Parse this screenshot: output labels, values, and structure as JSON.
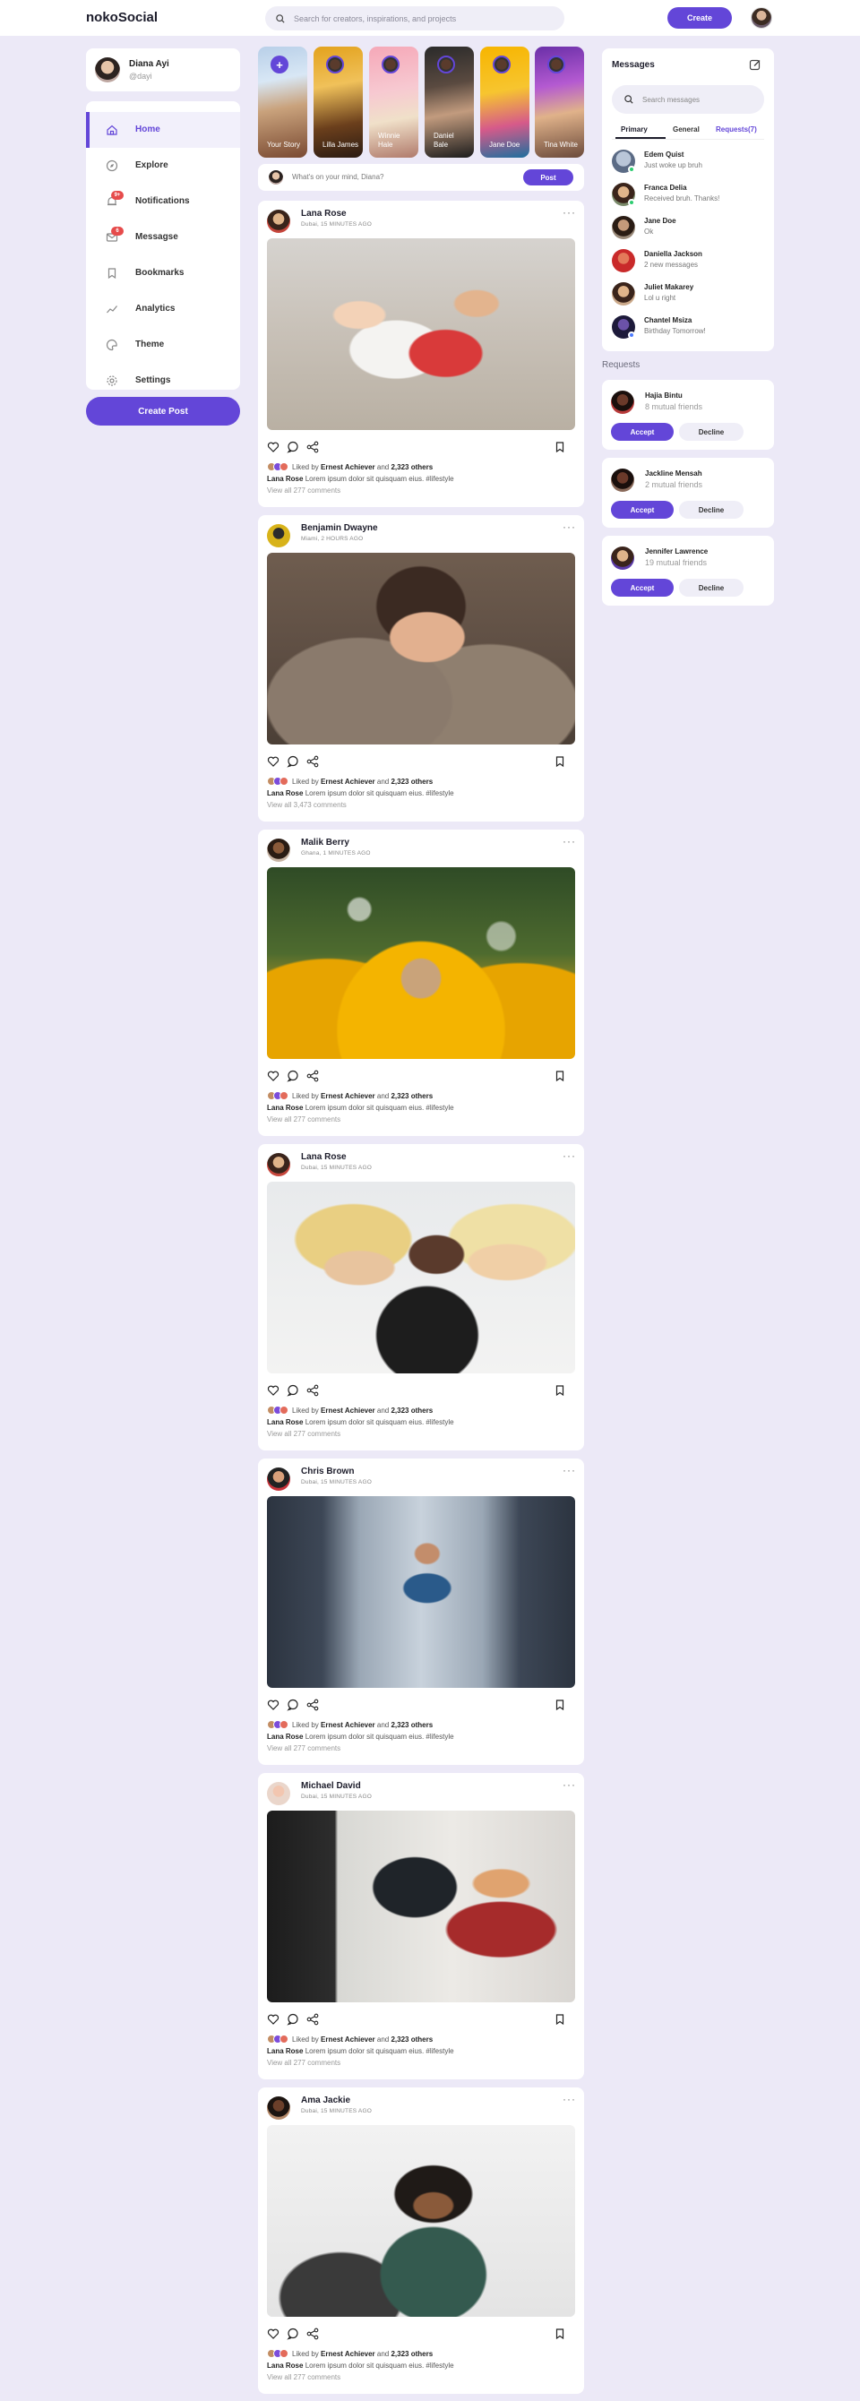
{
  "app": {
    "logo": "nokoSocial"
  },
  "topbar": {
    "search_placeholder": "Search for creators, inspirations, and projects",
    "create_label": "Create"
  },
  "profile": {
    "name": "Diana Ayi",
    "handle": "@dayi"
  },
  "sidebar": {
    "items": [
      {
        "label": "Home",
        "icon": "home-icon",
        "active": true
      },
      {
        "label": "Explore",
        "icon": "compass-icon"
      },
      {
        "label": "Notifications",
        "icon": "bell-icon",
        "badge": "9+"
      },
      {
        "label": "Messagse",
        "icon": "envelope-icon",
        "badge": "6"
      },
      {
        "label": "Bookmarks",
        "icon": "bookmark-icon"
      },
      {
        "label": "Analytics",
        "icon": "chart-icon"
      },
      {
        "label": "Theme",
        "icon": "palette-icon"
      },
      {
        "label": "Settings",
        "icon": "gear-icon"
      }
    ],
    "create_post_label": "Create Post"
  },
  "stories": [
    {
      "name": "Your Story"
    },
    {
      "name": "Lilla James"
    },
    {
      "name": "Winnie Hale"
    },
    {
      "name": "Daniel Bale"
    },
    {
      "name": "Jane Doe"
    },
    {
      "name": "Tina White"
    }
  ],
  "composer": {
    "placeholder": "What's on your mind, Diana?",
    "post_label": "Post"
  },
  "posts": [
    {
      "name": "Lana Rose",
      "meta": "Dubai, 15 MINUTES AGO",
      "liked_by": "Ernest Achiever",
      "liked_others": "2,323 others",
      "caption_name": "Lana Rose",
      "caption_text": "Lorem ipsum dolor sit quisquam eius. #lifestyle",
      "comments": "View all 277 comments"
    },
    {
      "name": "Benjamin Dwayne",
      "meta": "Miami, 2 HOURS AGO",
      "liked_by": "Ernest Achiever",
      "liked_others": "2,323 others",
      "caption_name": "Lana Rose",
      "caption_text": "Lorem ipsum dolor sit quisquam eius. #lifestyle",
      "comments": "View all 3,473 comments"
    },
    {
      "name": "Malik Berry",
      "meta": "Ghana, 1 MINUTES AGO",
      "liked_by": "Ernest Achiever",
      "liked_others": "2,323 others",
      "caption_name": "Lana Rose",
      "caption_text": "Lorem ipsum dolor sit quisquam eius. #lifestyle",
      "comments": "View all 277 comments"
    },
    {
      "name": "Lana Rose",
      "meta": "Dubai, 15 MINUTES AGO",
      "liked_by": "Ernest Achiever",
      "liked_others": "2,323 others",
      "caption_name": "Lana Rose",
      "caption_text": "Lorem ipsum dolor sit quisquam eius. #lifestyle",
      "comments": "View all 277 comments"
    },
    {
      "name": "Chris Brown",
      "meta": "Dubai, 15 MINUTES AGO",
      "liked_by": "Ernest Achiever",
      "liked_others": "2,323 others",
      "caption_name": "Lana Rose",
      "caption_text": "Lorem ipsum dolor sit quisquam eius. #lifestyle",
      "comments": "View all 277 comments"
    },
    {
      "name": "Michael David",
      "meta": "Dubai, 15 MINUTES AGO",
      "liked_by": "Ernest Achiever",
      "liked_others": "2,323 others",
      "caption_name": "Lana Rose",
      "caption_text": "Lorem ipsum dolor sit quisquam eius. #lifestyle",
      "comments": "View all 277 comments"
    },
    {
      "name": "Ama Jackie",
      "meta": "Dubai, 15 MINUTES AGO",
      "liked_by": "Ernest Achiever",
      "liked_others": "2,323 others",
      "caption_name": "Lana Rose",
      "caption_text": "Lorem ipsum dolor sit quisquam eius. #lifestyle",
      "comments": "View all 277 comments"
    }
  ],
  "messages": {
    "title": "Messages",
    "search_placeholder": "Search messages",
    "tabs": {
      "primary": "Primary",
      "general": "General",
      "requests": "Requests(7)"
    },
    "items": [
      {
        "name": "Edem Quist",
        "text": "Just woke up bruh"
      },
      {
        "name": "Franca Delia",
        "text": "Received bruh. Thanks!"
      },
      {
        "name": "Jane Doe",
        "text": "Ok"
      },
      {
        "name": "Daniella Jackson",
        "text": "2 new messages"
      },
      {
        "name": "Juliet Makarey",
        "text": "Lol u right"
      },
      {
        "name": "Chantel Msiza",
        "text": "Birthday Tomorrow!"
      }
    ]
  },
  "requests": {
    "title": "Requests",
    "accept_label": "Accept",
    "decline_label": "Decline",
    "items": [
      {
        "name": "Hajia Bintu",
        "mutual": "8 mutual friends"
      },
      {
        "name": "Jackline Mensah",
        "mutual": "2 mutual friends"
      },
      {
        "name": "Jennifer Lawrence",
        "mutual": "19 mutual friends"
      }
    ]
  },
  "colors": {
    "accent": "#6346d8",
    "background": "#ece9f7",
    "badge": "#e64b4b",
    "online": "#2ecc71"
  }
}
